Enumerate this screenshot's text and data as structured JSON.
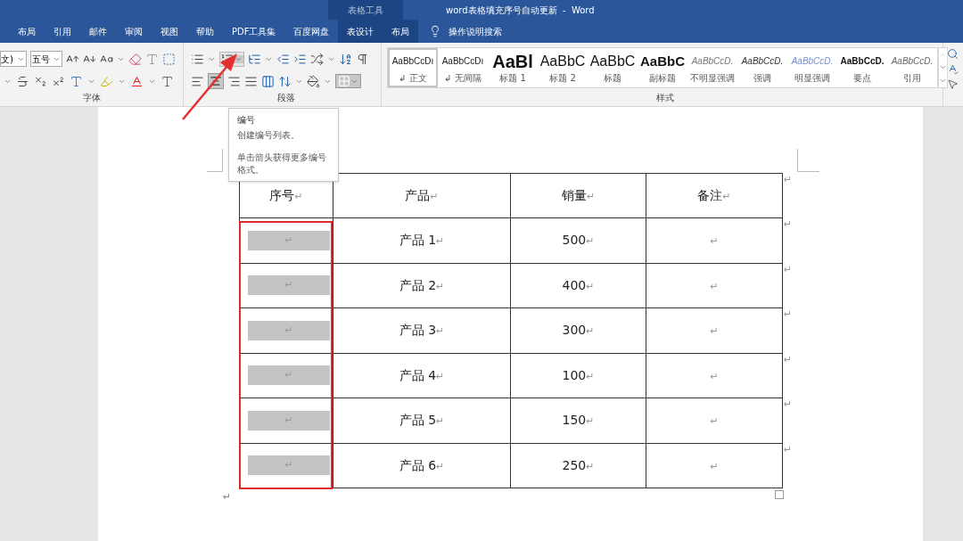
{
  "title_bar": {
    "title": "word表格填充序号自动更新  -  Word",
    "context_label": "表格工具"
  },
  "tabs": [
    {
      "label": "布局",
      "selected": false,
      "contextual": false
    },
    {
      "label": "引用",
      "selected": false,
      "contextual": false
    },
    {
      "label": "邮件",
      "selected": false,
      "contextual": false
    },
    {
      "label": "审阅",
      "selected": false,
      "contextual": false
    },
    {
      "label": "视图",
      "selected": false,
      "contextual": false
    },
    {
      "label": "帮助",
      "selected": false,
      "contextual": false
    },
    {
      "label": "PDF工具集",
      "selected": false,
      "contextual": false
    },
    {
      "label": "百度网盘",
      "selected": false,
      "contextual": false
    },
    {
      "label": "表设计",
      "selected": false,
      "contextual": true
    },
    {
      "label": "布局",
      "selected": false,
      "contextual": true
    }
  ],
  "tell_me": {
    "placeholder": "操作说明搜索"
  },
  "font_group": {
    "label": "字体",
    "font_name": "文)",
    "font_size": "五号"
  },
  "paragraph_group": {
    "label": "段落"
  },
  "styles_group": {
    "label": "样式",
    "styles": [
      {
        "preview": "AaBbCcDı",
        "name": "正文",
        "prefix": "↲",
        "kind": "body",
        "selected": true
      },
      {
        "preview": "AaBbCcDı",
        "name": "无间隔",
        "prefix": "↲",
        "kind": "body",
        "selected": false
      },
      {
        "preview": "AaBl",
        "name": "标题 1",
        "kind": "heading1",
        "selected": false
      },
      {
        "preview": "AaBbC",
        "name": "标题 2",
        "kind": "heading2",
        "selected": false
      },
      {
        "preview": "AaBbC",
        "name": "标题",
        "kind": "title",
        "selected": false
      },
      {
        "preview": "AaBbC",
        "name": "副标题",
        "kind": "subtitle",
        "selected": false
      },
      {
        "preview": "AaBbCcD.",
        "name": "不明显强调",
        "kind": "subtle",
        "selected": false
      },
      {
        "preview": "AaBbCcD.",
        "name": "强调",
        "kind": "emphasis",
        "selected": false
      },
      {
        "preview": "AaBbCcD.",
        "name": "明显强调",
        "kind": "intense",
        "selected": false
      },
      {
        "preview": "AaBbCcD.",
        "name": "要点",
        "kind": "strong",
        "selected": false
      },
      {
        "preview": "AaBbCcD.",
        "name": "引用",
        "kind": "quote",
        "selected": false
      }
    ]
  },
  "tooltip": {
    "title": "编号",
    "lines": [
      "创建编号列表。",
      "单击箭头获得更多编号格式。"
    ]
  },
  "table": {
    "columns": [
      {
        "text": "序号",
        "mark": "↵"
      },
      {
        "text": "产品",
        "mark": "↵"
      },
      {
        "text": "销量",
        "mark": "↵"
      },
      {
        "text": "备注",
        "mark": "↵"
      }
    ],
    "header_end_mark": "↵",
    "rows": [
      {
        "cells": [
          {
            "mark": "↵",
            "shaded": true
          },
          {
            "text": "产品 1",
            "mark": "↵"
          },
          {
            "text": "500",
            "mark": "↵"
          },
          {
            "mark": "↵"
          }
        ],
        "end_mark": "↵"
      },
      {
        "cells": [
          {
            "mark": "↵",
            "shaded": true
          },
          {
            "text": "产品 2",
            "mark": "↵"
          },
          {
            "text": "400",
            "mark": "↵"
          },
          {
            "mark": "↵"
          }
        ],
        "end_mark": "↵"
      },
      {
        "cells": [
          {
            "mark": "↵",
            "shaded": true
          },
          {
            "text": "产品 3",
            "mark": "↵"
          },
          {
            "text": "300",
            "mark": "↵"
          },
          {
            "mark": "↵"
          }
        ],
        "end_mark": "↵"
      },
      {
        "cells": [
          {
            "mark": "↵",
            "shaded": true
          },
          {
            "text": "产品 4",
            "mark": "↵"
          },
          {
            "text": "100",
            "mark": "↵"
          },
          {
            "mark": "↵"
          }
        ],
        "end_mark": "↵"
      },
      {
        "cells": [
          {
            "mark": "↵",
            "shaded": true
          },
          {
            "text": "产品 5",
            "mark": "↵"
          },
          {
            "text": "150",
            "mark": "↵"
          },
          {
            "mark": "↵"
          }
        ],
        "end_mark": "↵"
      },
      {
        "cells": [
          {
            "mark": "↵",
            "shaded": true
          },
          {
            "text": "产品 6",
            "mark": "↵"
          },
          {
            "text": "250",
            "mark": "↵"
          },
          {
            "mark": "↵"
          }
        ],
        "end_mark": "↵"
      }
    ]
  },
  "after_table_mark": "↵"
}
